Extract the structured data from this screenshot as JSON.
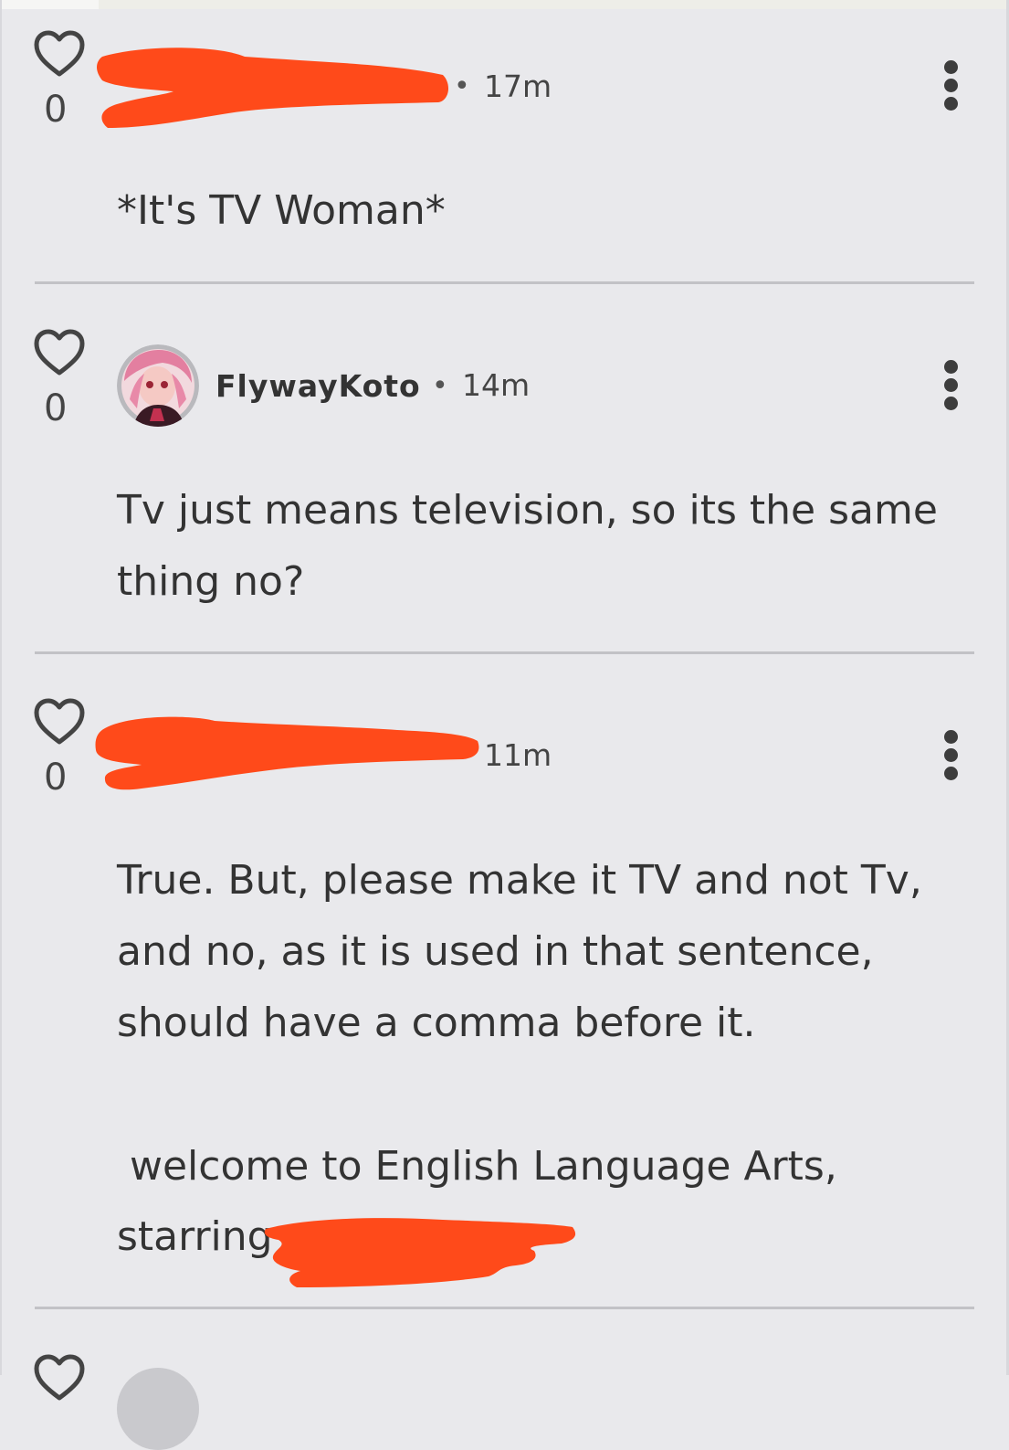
{
  "comments": [
    {
      "likes": "0",
      "time": "17m",
      "text": "*It's TV Woman*"
    },
    {
      "likes": "0",
      "username": "FlywayKoto",
      "time": "14m",
      "text": "Tv just means television, so its the same thing no?"
    },
    {
      "likes": "0",
      "time": "11m",
      "text": "True. But, please make it TV and not Tv, and no, as it is used in that sentence, should have a comma before it.",
      "text2": " welcome to English Language Arts,",
      "text3": "starring"
    }
  ],
  "separator": "•",
  "icons": {
    "like": "heart-outline-icon",
    "more": "vertical-ellipsis-icon"
  },
  "colors": {
    "background": "#e9e9ec",
    "redaction": "#ff4a1a",
    "text": "#333333",
    "divider": "#c2c2c6"
  }
}
